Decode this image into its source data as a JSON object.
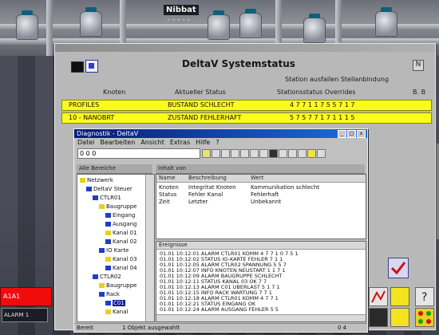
{
  "plant": {
    "tag": "Nibbat",
    "subtag": "- - -  - -"
  },
  "status_window": {
    "title": "DeltaV Systemstatus",
    "close_glyph": "N",
    "note": "Station ausfallen Stellanbindung",
    "columns": [
      "Knoten",
      "Aktueller Status",
      "Stationsstatus Overrides",
      "B. B"
    ],
    "rows": [
      {
        "node": "PROFILES",
        "status": "BUSTAND SCHLECHT",
        "detail": "4 7 7 1 1 7 5 5 7 1 7"
      },
      {
        "node": "10 - NANOBRT",
        "status": "ZUSTAND FEHLERHAFT",
        "detail": "5 7 5 7 7 1 7 1 1 1 5"
      }
    ]
  },
  "diag_window": {
    "title": "Diagnostik - DeltaV",
    "title_buttons": [
      "_",
      "□",
      "x"
    ],
    "menu": [
      "Datei",
      "Bearbeiten",
      "Ansicht",
      "Extras",
      "Hilfe",
      "?"
    ],
    "combo_value": "0 0 0",
    "left_header": "Alle Bereiche",
    "right_header": "Inhalt von",
    "tree": [
      {
        "label": "Netzwerk",
        "depth": 0,
        "selected": false
      },
      {
        "label": "DeltaV Steuer",
        "depth": 1,
        "selected": false
      },
      {
        "label": "CTLR01",
        "depth": 2,
        "selected": false
      },
      {
        "label": "Baugruppe",
        "depth": 3,
        "selected": false
      },
      {
        "label": "Eingang",
        "depth": 4,
        "selected": false
      },
      {
        "label": "Ausgang",
        "depth": 4,
        "selected": false
      },
      {
        "label": "Kanal 01",
        "depth": 4,
        "selected": false
      },
      {
        "label": "Kanal 02",
        "depth": 4,
        "selected": false
      },
      {
        "label": "IO Karte",
        "depth": 3,
        "selected": false
      },
      {
        "label": "Kanal 03",
        "depth": 4,
        "selected": false
      },
      {
        "label": "Kanal 04",
        "depth": 4,
        "selected": false
      },
      {
        "label": "CTLR02",
        "depth": 2,
        "selected": false
      },
      {
        "label": "Baugruppe",
        "depth": 3,
        "selected": false
      },
      {
        "label": "Rack",
        "depth": 3,
        "selected": false
      },
      {
        "label": "C01",
        "depth": 4,
        "selected": true
      },
      {
        "label": "Kanal",
        "depth": 4,
        "selected": false
      }
    ],
    "list_columns": [
      "Name",
      "Beschreibung",
      "Wert"
    ],
    "list_rows": [
      {
        "name": "Knoten",
        "desc": "Integritat Knoten",
        "value": "Kommunikation schlecht"
      },
      {
        "name": "Status",
        "desc": "Fehler Kanal",
        "value": "Fehlerhaft"
      },
      {
        "name": "Zeit",
        "desc": "Letzter",
        "value": "Unbekannt"
      }
    ],
    "log_header": "Ereignisse",
    "log_lines": [
      "01.01 10:12:01  ALARM  CTLR01  KOMM  4 7 7 1 0 7 5 1",
      "01.01 10:12:02  STATUS  IO-KARTE  FEHLER  7 1 1",
      "01.01 10:12:05  ALARM  CTLR02  SPANNUNG  5 5 7",
      "01.01 10:12:07  INFO  KNOTEN  NEUSTART  1 1 7 1",
      "01.01 10:12:09  ALARM  BAUGRUPPE  SCHLECHT",
      "01.01 10:12:11  STATUS  KANAL 03  OK  7 7",
      "01.01 10:12:13  ALARM  C01  UBERLAST  5 1 7 1",
      "01.01 10:12:15  INFO  RACK  WARTUNG  7 7 1",
      "01.01 10:12:18  ALARM  CTLR01  KOMM  4 7 7 1",
      "01.01 10:12:21  STATUS  EINGANG  OK",
      "01.01 10:12:24  ALARM  AUSGANG  FEHLER 5 5"
    ],
    "status_left": "Bereit",
    "status_mid": "1 Objekt ausgewahlt",
    "status_right": "0 4"
  },
  "hmi": {
    "alarm_label": "A1A1",
    "alarm_sub": "ALARM 1",
    "colors": {
      "alarm": "#f10c0c",
      "status_row": "#fbfb1e",
      "title_active": "#0a1a78"
    }
  }
}
